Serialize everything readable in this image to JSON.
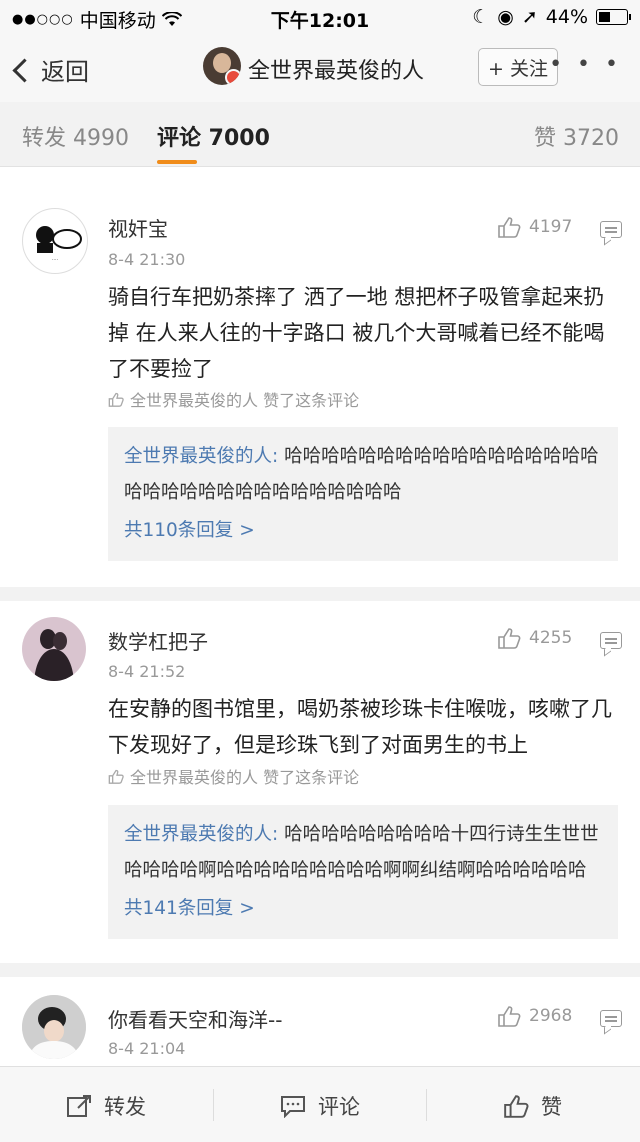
{
  "status_bar": {
    "carrier": "中国移动",
    "time": "下午12:01",
    "battery": "44%",
    "signal_icon": "signal-dots-icon",
    "wifi_icon": "wifi-icon"
  },
  "nav": {
    "back_label": "返回",
    "title": "全世界最英俊的人",
    "follow_label": "+ 关注",
    "more_label": "• • •"
  },
  "tabs": [
    {
      "label": "转发 4990",
      "active": false
    },
    {
      "label": "评论 7000",
      "active": true
    },
    {
      "label": "赞 3720",
      "active": false
    }
  ],
  "comments": [
    {
      "name": "视奸宝",
      "time": "8-4 21:30",
      "likes": "4197",
      "text": "骑自行车把奶茶摔了 洒了一地 想把杯子吸管拿起来扔掉 在人来人往的十字路口 被几个大哥喊着已经不能喝了不要捡了",
      "liked_by": "全世界最英俊的人 赞了这条评论",
      "reply": {
        "author": "全世界最英俊的人:",
        "text": " 哈哈哈哈哈哈哈哈哈哈哈哈哈哈哈哈哈哈哈哈哈哈哈哈哈哈哈哈哈哈哈哈",
        "count": "共110条回复 >"
      }
    },
    {
      "name": "数学杠把子",
      "time": "8-4 21:52",
      "likes": "4255",
      "text": "在安静的图书馆里，喝奶茶被珍珠卡住喉咙，咳嗽了几下发现好了，但是珍珠飞到了对面男生的书上",
      "liked_by": "全世界最英俊的人 赞了这条评论",
      "reply": {
        "author": "全世界最英俊的人:",
        "text": " 哈哈哈哈哈哈哈哈哈十四行诗生生世世哈哈哈哈啊哈哈哈哈哈哈哈哈哈啊啊纠结啊哈哈哈哈哈哈",
        "count": "共141条回复 >"
      }
    },
    {
      "name": "你看看天空和海洋--",
      "time": "8-4 21:04",
      "likes": "2968"
    }
  ],
  "bottom_bar": {
    "repost": "转发",
    "comment": "评论",
    "like": "赞"
  },
  "colors": {
    "accent": "#f08c1a",
    "link": "#4d7ab1"
  }
}
